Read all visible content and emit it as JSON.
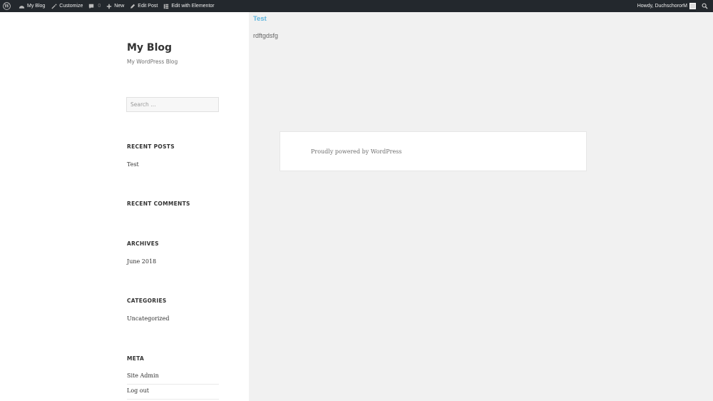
{
  "adminbar": {
    "site_name": "My Blog",
    "customize": "Customize",
    "comments_count": "0",
    "new": "New",
    "edit_post": "Edit Post",
    "edit_elementor": "Edit with Elementor",
    "howdy": "Howdy, DuchschororM"
  },
  "site": {
    "title": "My Blog",
    "description": "My WordPress Blog"
  },
  "search": {
    "placeholder": "Search …"
  },
  "widgets": {
    "recent_posts": {
      "title": "RECENT POSTS",
      "items": [
        "Test"
      ]
    },
    "recent_comments": {
      "title": "RECENT COMMENTS"
    },
    "archives": {
      "title": "ARCHIVES",
      "items": [
        "June 2018"
      ]
    },
    "categories": {
      "title": "CATEGORIES",
      "items": [
        "Uncategorized"
      ]
    },
    "meta": {
      "title": "META",
      "items": [
        "Site Admin",
        "Log out"
      ]
    }
  },
  "post": {
    "title": "Test",
    "body": "rdftgdsfg"
  },
  "footer": {
    "text": "Proudly powered by WordPress"
  },
  "colors": {
    "adminbar_bg": "#23282d",
    "link": "#5eb5de",
    "main_bg": "#f1f1f1"
  }
}
